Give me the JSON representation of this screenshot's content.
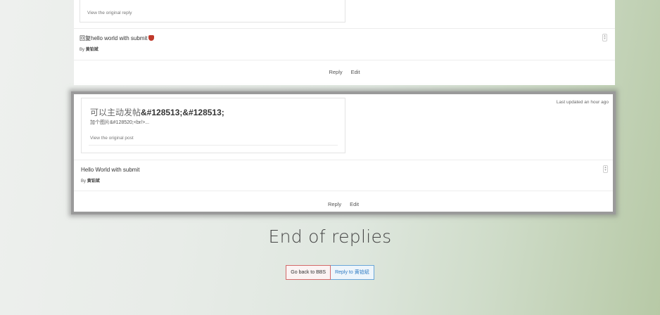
{
  "thread": {
    "first_reply": {
      "quote_link": "View the original reply",
      "title": "回复hello world with submit",
      "title_icon": "shield-badge-icon",
      "by_prefix": "By",
      "author": "黄铂斌",
      "actions": [
        "Reply",
        "Edit"
      ]
    },
    "second_reply": {
      "quote_title_cn": "可以主动发帖",
      "quote_title_code": "&#128513;&#128513;",
      "quote_excerpt": "加个图片&#128520;<br/>...",
      "quote_link": "View the original post",
      "updated": "Last updated an hour ago",
      "title": "Hello World with submit",
      "by_prefix": "By",
      "author": "黄铂斌",
      "actions": [
        "Reply",
        "Edit"
      ]
    }
  },
  "footer": {
    "end_title": "End of replies",
    "back_button": "Go back to BBS",
    "reply_button": "Reply to 黄铂斌"
  },
  "colors": {
    "back_border": "#d36a6a",
    "reply_border": "#6aa6d8",
    "reply_text": "#2e7bc4"
  }
}
